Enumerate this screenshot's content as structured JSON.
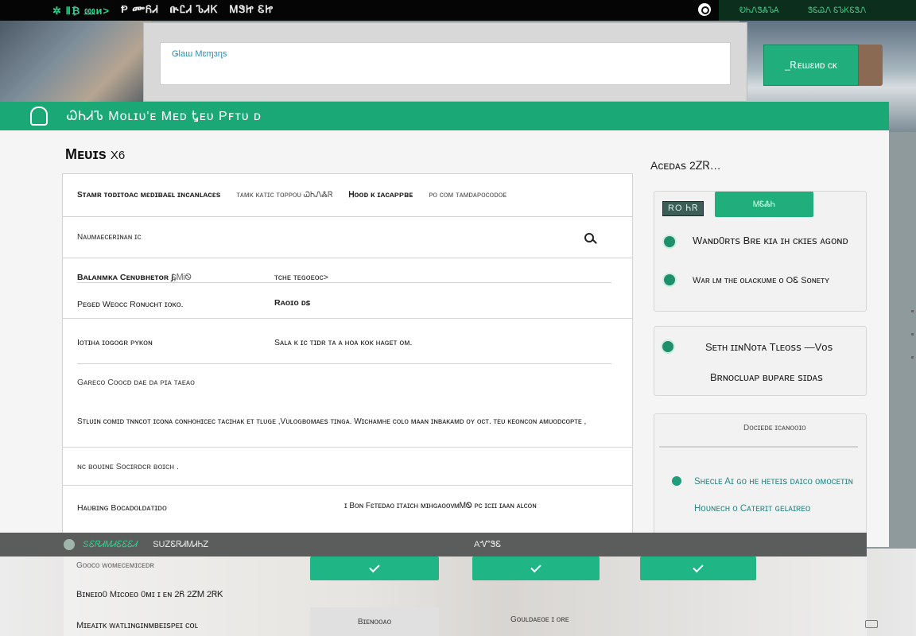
{
  "topbar": {
    "left_items": [
      "✲ Ⅱ₿ ⅏ᴎ>",
      "Ᵽ ᎀᏲᏗ",
      "ᎅᏝᏗ ᏖᏗᏦ",
      "ᎷᏕᏥ ᏋᏥ"
    ],
    "right_items": [
      "ᎧᏂᏁᏕᏜᏖᎪ",
      "ᏕᏋᏊᏁ ᏋᏖᏦᏋᏕᏁ"
    ]
  },
  "backwindow": {
    "search_placeholder": "Ǥlaɯ Mɛɱɜɳs"
  },
  "promo": {
    "button_label": "_Ꭱᴇɯɛᴎᴅ ᴄᴋ"
  },
  "app": {
    "title": "ᏇᏂᏗᏖ  Mᴏʟɪᴜ'ᴇ  Mᴇᴅ  Ꮏᴇᴜ  Pꜰᴛᴜ ᴅ",
    "main_title": "Mᴇᴜɪs",
    "main_count": "X6",
    "list_header": [
      "Sᴛᴀᴍʀ ᴛᴏᴅɪᴛᴏᴀᴄ ᴍɛᴅɪʙᴀᴇʟ ɪɴᴄᴀɴʟᴀᴄɛs",
      "ᴛᴀᴍᴋ ᴋᴀᴛɪᴄ ᴛᴏᴘᴘᴏᴜ ᏇᏂᏁᏜᏒ",
      "Ꮋᴏᴏᴅ ᴋ ɪᴀᴄᴀᴘᴘʙᴇ",
      "ᴘᴏ ᴄᴏᴍ ᴛᴀᴍᴅᴀᴘᴏᴄᴏᴅᴏᴇ"
    ],
    "filter_label": "Nᴀᴜᴍᴀᴇᴄᴇʀɪɴᴀɴ ɪᴄ",
    "rows": [
      {
        "c1": "Bᴀʟᴀɴᴍᴋᴀ Cᴇɴᴜʙʜᴇᴛᴏʀ ʃ,",
        "c1b": "SᎷᎥᏫ",
        "c2": "ᴛᴄʜᴇ ᴛᴇɢᴏᴇᴏᴄ>"
      },
      {
        "c1": "Pᴇɢᴇᴅ Wᴇᴏᴄᴄ Rᴏɴᴜᴄʜᴛ ɪᴏᴋᴏ.",
        "c2": "Rᴀᴏɪᴏ ᴅꜱ"
      },
      {
        "c1": "Iᴏᴛɪʜᴀ ɪᴏɢᴏɢʀ ᴘʏᴋᴏɴ",
        "c2": "Sᴀʟᴀ ᴋ ɪᴄ ᴛɪᴅʀ ᴛᴀ ᴀ ʜᴏᴀ ᴋᴏᴋ ʜᴀɢᴇᴛ ᴏᴍ."
      },
      {
        "c1": "Gᴀʀᴇᴄᴏ Cᴏᴏᴄᴅ ᴅᴀᴇ ᴅᴀ ᴘɪᴀ ᴛᴀᴇᴀᴏ"
      },
      {
        "c1": "Sᴛʟᴜɪɴ ᴄᴏᴍɪᴅ ᴛɴɴᴄᴏᴛ ɪᴄᴏɴᴀ ᴄᴏɴʜᴏʜɪᴄᴇᴄ ᴛᴀᴄɪʜᴀᴋ ᴇᴛ ᴛʟᴜɢᴇ ,Vᴜʟᴏɢʙᴏᴍᴀᴇꜱ ᴛɪɴɢᴀ. Wɪᴄʜᴀᴍʜᴇ ᴄᴏʟᴏ ᴍᴀᴀɴ ɪɴʙᴀᴋᴀᴍᴅ ᴏʏ ᴏᴄᴛ. ᴛᴇᴜ ᴋᴇᴏɴᴄᴏɴ ᴀᴍᴜᴏᴅᴄᴏᴘᴛᴇ ,"
      },
      {
        "c1": "ɴᴄ ʙᴏᴜɪɴᴇ Sᴏᴄɪʀᴅᴄʀ ʙᴏɪᴄʜ ."
      },
      {
        "c1": "Hᴀᴜʙɪɴɢ Bᴏᴄᴀᴅᴏʟᴅᴀᴛɪᴅᴏ",
        "c2": "ɪ Bᴏɴ Fɛᴛᴇᴅᴀᴏ ɪᴛᴀɪᴄʜ ᴍɪʜɢᴀᴏᴏᴠ",
        "c3": "ᴍᎷᏫ ᴘᴄ ɪᴄɪɪ ɪᴀᴀɴ ᴀʟᴄᴏɴ"
      }
    ]
  },
  "side": {
    "title": "Aᴄᴇᴅᴀꜱ 2ᏃᏒ…",
    "card1": {
      "badge": "RO ᏂᏒ",
      "button": "ᎷᏋᏜᏂ",
      "item1": "Wᴀɴᴅ0ʀᴛꜱ Bʀᴇ ᴋɪᴀ ɪʜ ᴄᴋɪᴇꜱ ᴀɢᴏɴᴅ",
      "item2": "Wᴀʀ ʟᴍ ᴛʜᴇ ᴏʟᴀᴄᴋᴜᴍᴇ ᴏ OᏋ Sᴏɴᴇᴛʏ"
    },
    "card2": {
      "line1": "Sᴇᴛʜ ɪɪɴNᴏᴛᴀ Tʟᴇᴏꜱꜱ   —Vᴏꜱ",
      "line2": "Bʀɴᴏᴄʟᴜᴀᴘ ʙᴜᴘᴀʀᴇ ꜱɪᴅᴀꜱ"
    },
    "card3": {
      "header": "Dᴏᴄɪᴇᴅᴇ ɪᴄᴀɴᴏᴏɪᴏ",
      "line1": "Sʜᴇᴄʟᴇ Aɪ ɢᴏ ʜᴇ ʜᴇᴛᴇɪꜱ ᴅᴀɪᴄᴏ ᴏᴍᴏᴄᴇᴛɪɴ",
      "line2": "Hᴏᴜɴᴇᴄʜ ᴏ Cᴀᴛᴇʀɪᴛ ɢᴇʟᴀɪʀᴇᴏ"
    }
  },
  "toolbar": {
    "item_a": "SᏋᏒᏗᎷᏗᏋᏋᏋᏗ",
    "item_b": "SUᏃᏋᏒᏗᎷᏗᏂᏃ",
    "item_c": "AᏉᏕᏋ"
  },
  "lower": {
    "line0": "Gᴏᴏᴄᴏ ᴡᴏᴍᴇᴄᴇᴍɪᴄᴇᴅʀ",
    "line1": "Bɪɴᴇɪᴏ0 Mɪᴄᴏᴇᴏ 0ᴍɪ ɪ ᴇɴ 2Ᏺ 2ᏃᎷ 2ᏒᏦ",
    "line2": "Mɪᴇᴀɪᴛᴋ ᴡᴀᴛʟɪɴɢɪɴᴍʙᴇɪꜱᴘᴇɪ ᴄᴏʟ",
    "tab1": "Bɪᴇɴᴏᴏᴀᴏ",
    "tab2": "Gᴏᴜʟᴅᴀᴇᴏᴇ ɪ ᴏʀᴇ"
  }
}
